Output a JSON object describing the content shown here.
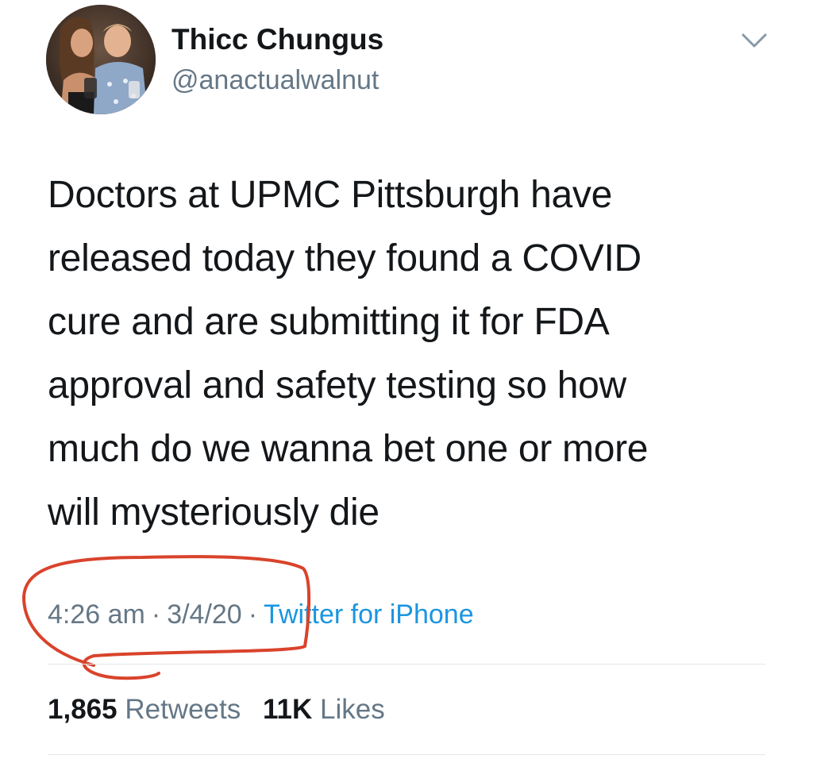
{
  "user": {
    "display_name": "Thicc Chungus",
    "handle": "@anactualwalnut",
    "avatar_icon": "profile-photo"
  },
  "menu": {
    "icon": "chevron-down-icon"
  },
  "tweet": {
    "lines": [
      "Doctors at UPMC Pittsburgh have",
      "released today they found a COVID",
      "cure and are submitting it for FDA",
      "approval and safety testing so how",
      "much do we wanna bet one or more",
      "will mysteriously die"
    ]
  },
  "meta": {
    "time": "4:26 am",
    "separator": "·",
    "date": "3/4/20",
    "source": "Twitter for iPhone"
  },
  "stats": {
    "retweets_count": "1,865",
    "retweets_label": "Retweets",
    "likes_count": "11K",
    "likes_label": "Likes"
  },
  "colors": {
    "text": "#14171a",
    "secondary": "#657786",
    "link": "#1b95e0",
    "annotation": "#d9432b",
    "divider": "#e1e8ed"
  }
}
